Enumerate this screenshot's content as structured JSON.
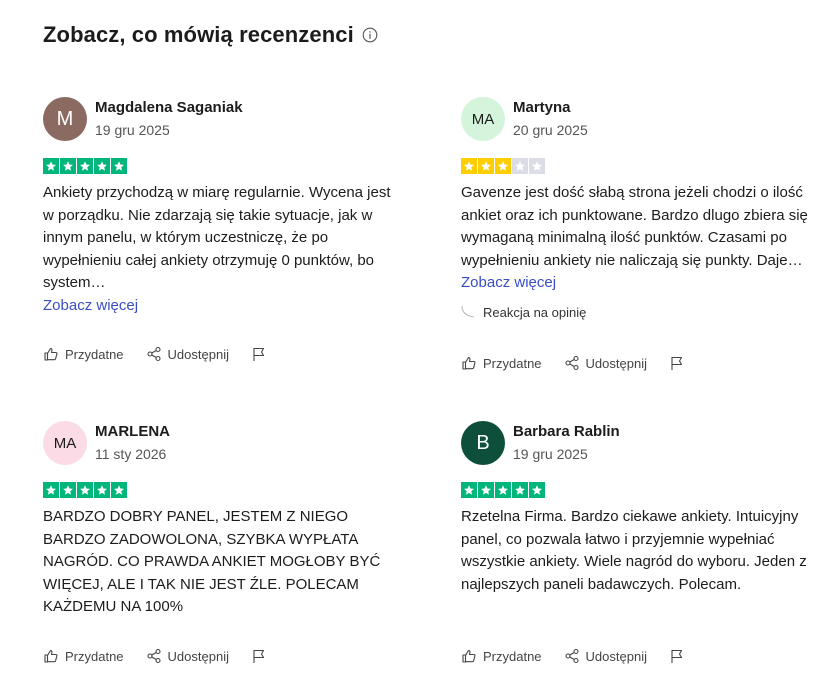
{
  "header": {
    "title": "Zobacz, co mówią recenzenci"
  },
  "colors": {
    "star_green": "#00b67a",
    "star_yellow": "#ffce00",
    "star_empty": "#dcdce6",
    "link": "#3a4ec2"
  },
  "reviews": [
    {
      "name": "Magdalena Saganiak",
      "date": "19 gru 2025",
      "initials": "M",
      "rating": 5,
      "text": "Ankiety przychodzą w miarę regularnie. Wycena jest w porządku. Nie zdarzają się takie sytuacje, jak w innym panelu, w którym uczestniczę, że po wypełnieniu całej ankiety otrzymuję 0 punktów, bo system…",
      "more": "Zobacz więcej"
    },
    {
      "name": "Martyna",
      "date": "20 gru 2025",
      "initials": "MA",
      "rating": 3,
      "text": "Gavenze jest dość słabą strona jeżeli chodzi o ilość ankiet oraz ich punktowane. Bardzo dlugo zbiera się wymaganą minimalną ilość punktów. Czasami po wypełnieniu ankiety nie naliczają się punkty. Daje…",
      "more": "Zobacz więcej",
      "reaction": "Reakcja na opinię"
    },
    {
      "name": "MARLENA",
      "date": "11 sty 2026",
      "initials": "MA",
      "rating": 5,
      "text": "BARDZO DOBRY PANEL, JESTEM Z NIEGO BARDZO ZADOWOLONA, SZYBKA WYPŁATA NAGRÓD. CO PRAWDA ANKIET MOGŁOBY BYĆ WIĘCEJ, ALE I TAK NIE JEST ŹLE. POLECAM KAŻDEMU NA 100%"
    },
    {
      "name": "Barbara Rablin",
      "date": "19 gru 2025",
      "initials": "B",
      "rating": 5,
      "text": "Rzetelna Firma. Bardzo ciekawe ankiety. Intuicyjny panel, co pozwala łatwo i przyjemnie wypełniać wszystkie ankiety. Wiele nagród do wyboru. Jeden z najlepszych paneli badawczych. Polecam."
    }
  ],
  "actions": {
    "useful": "Przydatne",
    "share": "Udostępnij"
  }
}
